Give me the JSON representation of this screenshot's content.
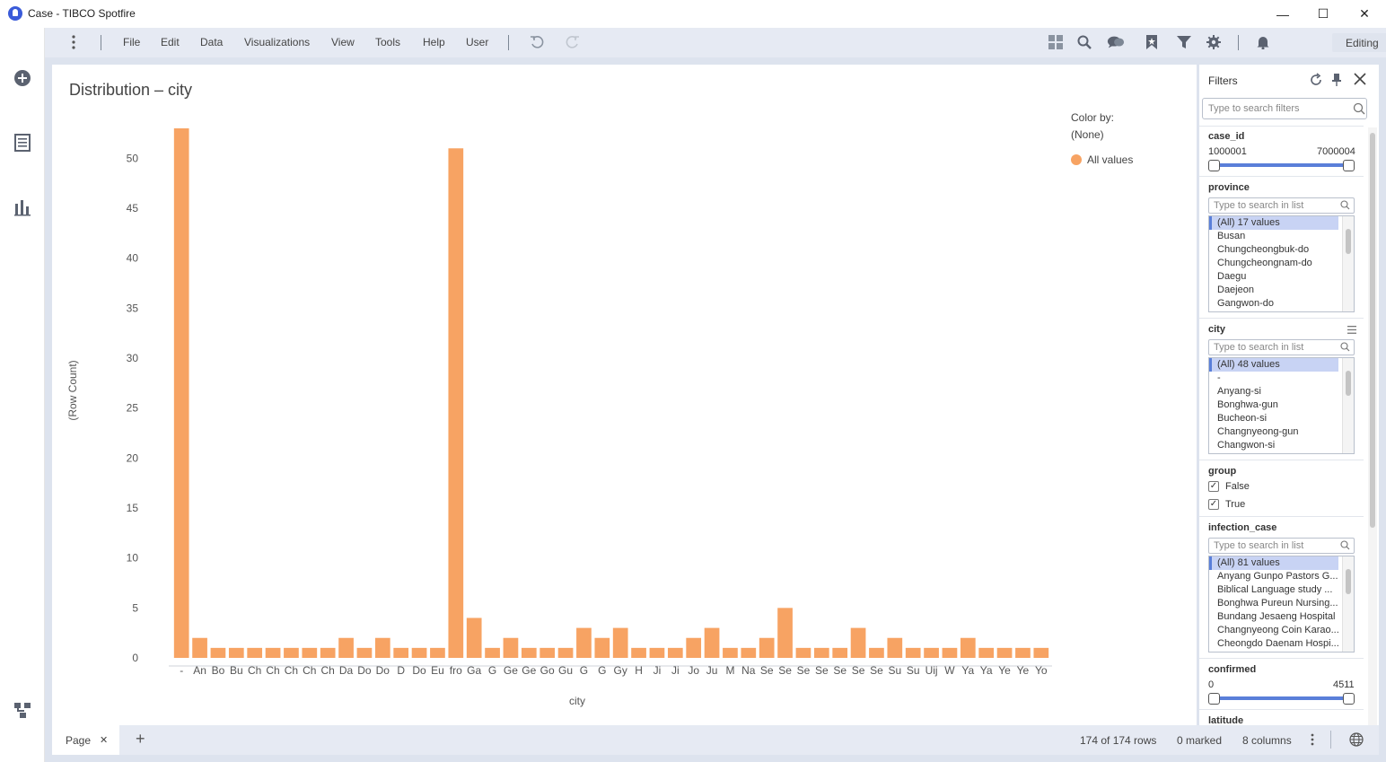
{
  "window": {
    "title": "Case - TIBCO Spotfire",
    "minimize": "—",
    "maximize": "☐",
    "close": "✕"
  },
  "menu": {
    "items": [
      "File",
      "Edit",
      "Data",
      "Visualizations",
      "View",
      "Tools",
      "Help",
      "User"
    ],
    "mode": "Editing"
  },
  "visualization": {
    "title": "Distribution – city"
  },
  "legend": {
    "color_by_label": "Color by:",
    "color_by_value": "(None)",
    "entry": "All values",
    "color": "#f7a363"
  },
  "chart_data": {
    "type": "bar",
    "title": "Distribution – city",
    "xlabel": "city",
    "ylabel": "(Row Count)",
    "ylim": [
      0,
      53
    ],
    "yticks": [
      0,
      5,
      10,
      15,
      20,
      25,
      30,
      35,
      40,
      45,
      50
    ],
    "bar_color": "#f7a363",
    "categories": [
      "-",
      "An",
      "Bo",
      "Bu",
      "Ch",
      "Ch",
      "Ch",
      "Ch",
      "Ch",
      "Da",
      "Do",
      "Do",
      "D",
      "Do",
      "Eu",
      "fro",
      "Ga",
      "G",
      "Ge",
      "Ge",
      "Go",
      "Gu",
      "G",
      "G",
      "Gy",
      "H",
      "Ji",
      "Ji",
      "Jo",
      "Ju",
      "M",
      "Na",
      "Se",
      "Se",
      "Se",
      "Se",
      "Se",
      "Se",
      "Se",
      "Su",
      "Su",
      "Uij",
      "W",
      "Ya",
      "Ya",
      "Ye",
      "Ye",
      "Yo"
    ],
    "values": [
      53,
      2,
      1,
      1,
      1,
      1,
      1,
      1,
      1,
      2,
      1,
      2,
      1,
      1,
      1,
      51,
      4,
      1,
      2,
      1,
      1,
      1,
      3,
      2,
      3,
      1,
      1,
      1,
      2,
      3,
      1,
      1,
      2,
      5,
      1,
      1,
      1,
      3,
      1,
      2,
      1,
      1,
      1,
      2,
      1,
      1,
      1,
      1
    ]
  },
  "filters": {
    "title": "Filters",
    "search_placeholder": "Type to search filters",
    "case_id": {
      "label": "case_id",
      "min": "1000001",
      "max": "7000004"
    },
    "province": {
      "label": "province",
      "search_placeholder": "Type to search in list",
      "items": [
        "(All) 17 values",
        "Busan",
        "Chungcheongbuk-do",
        "Chungcheongnam-do",
        "Daegu",
        "Daejeon",
        "Gangwon-do"
      ]
    },
    "city": {
      "label": "city",
      "search_placeholder": "Type to search in list",
      "items": [
        "(All) 48 values",
        "-",
        "Anyang-si",
        "Bonghwa-gun",
        "Bucheon-si",
        "Changnyeong-gun",
        "Changwon-si"
      ]
    },
    "group": {
      "label": "group",
      "options": [
        "False",
        "True"
      ],
      "check": "✓"
    },
    "infection_case": {
      "label": "infection_case",
      "search_placeholder": "Type to search in list",
      "items": [
        "(All) 81 values",
        "Anyang Gunpo Pastors G...",
        "Biblical Language study ...",
        "Bonghwa Pureun Nursing...",
        "Bundang Jesaeng Hospital",
        "Changnyeong Coin Karao...",
        "Cheongdo Daenam Hospi..."
      ]
    },
    "confirmed": {
      "label": "confirmed",
      "min": "0",
      "max": "4511"
    },
    "latitude": {
      "label": "latitude"
    }
  },
  "status": {
    "page_tab": "Page",
    "page_close": "✕",
    "add": "+",
    "rows": "174 of 174 rows",
    "marked": "0 marked",
    "columns": "8 columns"
  }
}
